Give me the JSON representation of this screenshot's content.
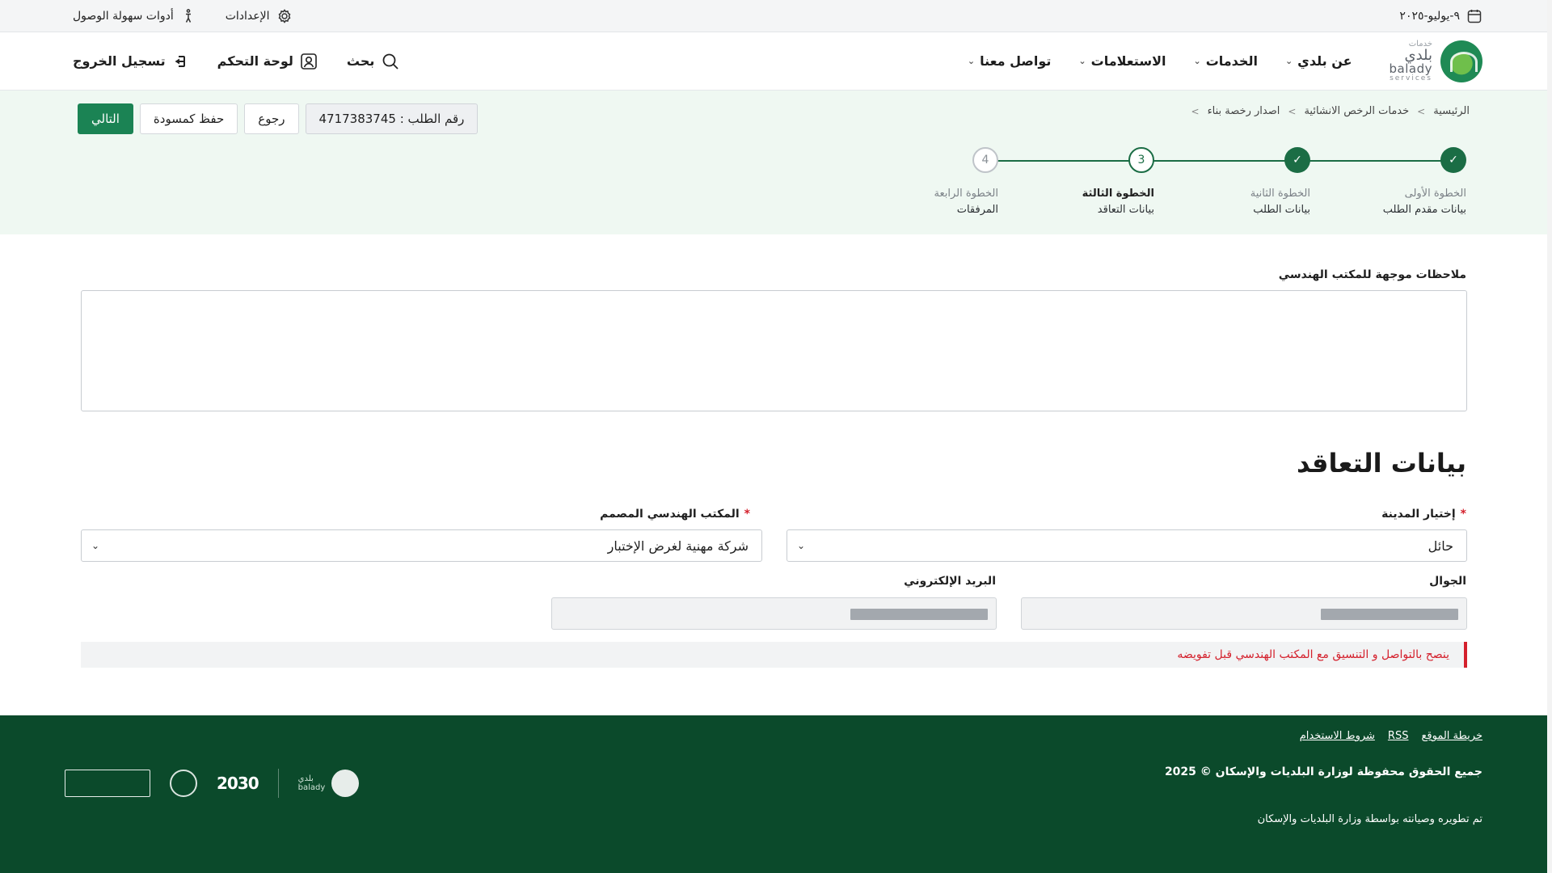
{
  "topbar": {
    "date": "٩-يوليو-٢٠٢٥",
    "settings": "الإعدادات",
    "accessibility": "أدوات سهولة الوصول"
  },
  "brand": {
    "ar_small": "خدمات",
    "ar": "بلدي",
    "en": "balady",
    "en2": "services"
  },
  "nav": {
    "items": [
      {
        "label": "عن بلدي"
      },
      {
        "label": "الخدمات"
      },
      {
        "label": "الاستعلامات"
      },
      {
        "label": "تواصل معنا"
      }
    ],
    "search": "بحث",
    "dashboard": "لوحة التحكم",
    "logout": "تسجيل الخروج"
  },
  "breadcrumb": {
    "items": [
      "الرئيسية",
      "خدمات الرخص الانشائية",
      "اصدار رخصة بناء"
    ],
    "separator": ">"
  },
  "request": {
    "number_label": "رقم الطلب : 4717383745",
    "back": "رجوع",
    "save_draft": "حفظ كمسودة",
    "next": "التالي"
  },
  "stepper": {
    "steps": [
      {
        "number": "1",
        "title": "الخطوة الأولى",
        "subtitle": "بيانات مقدم الطلب",
        "state": "done"
      },
      {
        "number": "2",
        "title": "الخطوة الثانية",
        "subtitle": "بيانات الطلب",
        "state": "done"
      },
      {
        "number": "3",
        "title": "الخطوة الثالثة",
        "subtitle": "بيانات التعاقد",
        "state": "current"
      },
      {
        "number": "4",
        "title": "الخطوة الرابعة",
        "subtitle": "المرفقات",
        "state": "todo"
      }
    ]
  },
  "form": {
    "notes_label": "ملاحظات موجهة للمكتب الهندسي",
    "notes_value": "",
    "section_title": "بيانات التعاقد",
    "city_label": "إختيار المدينة",
    "city_value": "حائل",
    "office_label": "المكتب الهندسي المصمم",
    "office_value": "شركة مهنية لغرض الإختبار",
    "mobile_label": "الجوال",
    "email_label": "البريد الإلكتروني",
    "required_mark": "*",
    "advice": "ينصح بالتواصل و التنسيق مع المكتب الهندسي قبل تفويضه"
  },
  "footer": {
    "links": [
      "خريطة الموقع",
      "RSS",
      "شروط الاستخدام"
    ],
    "copyright": "جميع الحقوق محفوظة لوزارة البلديات والإسكان © 2025",
    "developed_by": "تم تطويره وصيانته بواسطة وزارة البلديات والإسكان",
    "logos": [
      "balady-logo",
      "vision-2030-logo",
      "quality-of-life-logo",
      "digital-government-badge"
    ],
    "vision_text": "2030"
  },
  "colors": {
    "primary_green": "#1b8354",
    "dark_green": "#0b4a2b",
    "step_green": "#1b6d45",
    "error_red": "#d4202c"
  }
}
